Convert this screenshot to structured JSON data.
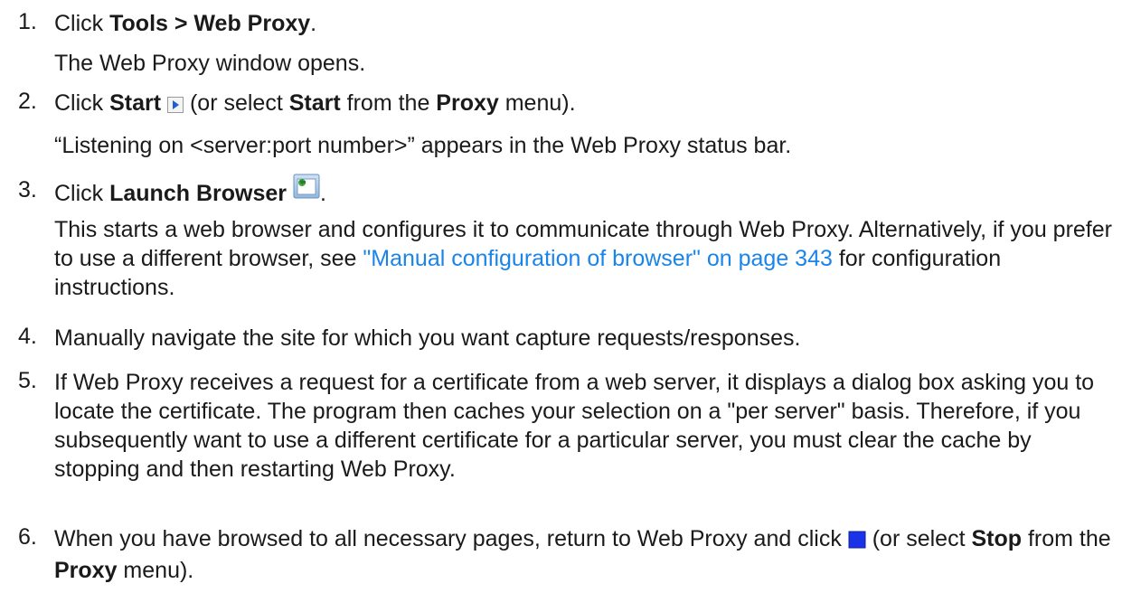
{
  "steps": [
    {
      "number": "1.",
      "pre": "Click ",
      "bold": "Tools > Web Proxy",
      "post": ".",
      "sub": "The Web Proxy window opens."
    },
    {
      "number": "2.",
      "pre": "Click ",
      "bold1": "Start",
      "mid1": " (or select ",
      "bold2": "Start",
      "mid2": " from the ",
      "bold3": "Proxy",
      "post": " menu).",
      "sub": "“Listening on <server:port number>” appears in the Web Proxy status bar."
    },
    {
      "number": "3.",
      "pre": "Click ",
      "bold": "Launch Browser",
      "post": ".",
      "sub_a": "This starts a web browser and configures it to communicate through Web Proxy. Alternatively, if you prefer to use a different browser, see ",
      "link": "\"Manual configuration of browser\" on page 343",
      "sub_b": " for configuration instructions."
    },
    {
      "number": "4.",
      "text": "Manually navigate the site for which you want capture requests/responses."
    },
    {
      "number": "5.",
      "text": "If Web Proxy receives a request for a certificate from a web server, it displays a dialog box asking you to locate the certificate. The program then caches your selection on a \"per server\" basis. Therefore, if you subsequently want to use a different certificate for a particular server, you must clear the cache by stopping and then restarting Web Proxy."
    },
    {
      "number": "6.",
      "pre": "When you have browsed to all necessary pages, return to Web Proxy and click ",
      "mid1": " (or select ",
      "bold1": "Stop",
      "mid2": " from the ",
      "bold2": "Proxy",
      "post": " menu)."
    }
  ],
  "icons": {
    "start": "play-icon",
    "launch": "launch-browser-icon",
    "stop": "stop-icon"
  },
  "colors": {
    "text": "#1a1a1a",
    "link": "#1a84e8",
    "stop_blue": "#1a33e6",
    "play_blue": "#1f5fd0"
  }
}
